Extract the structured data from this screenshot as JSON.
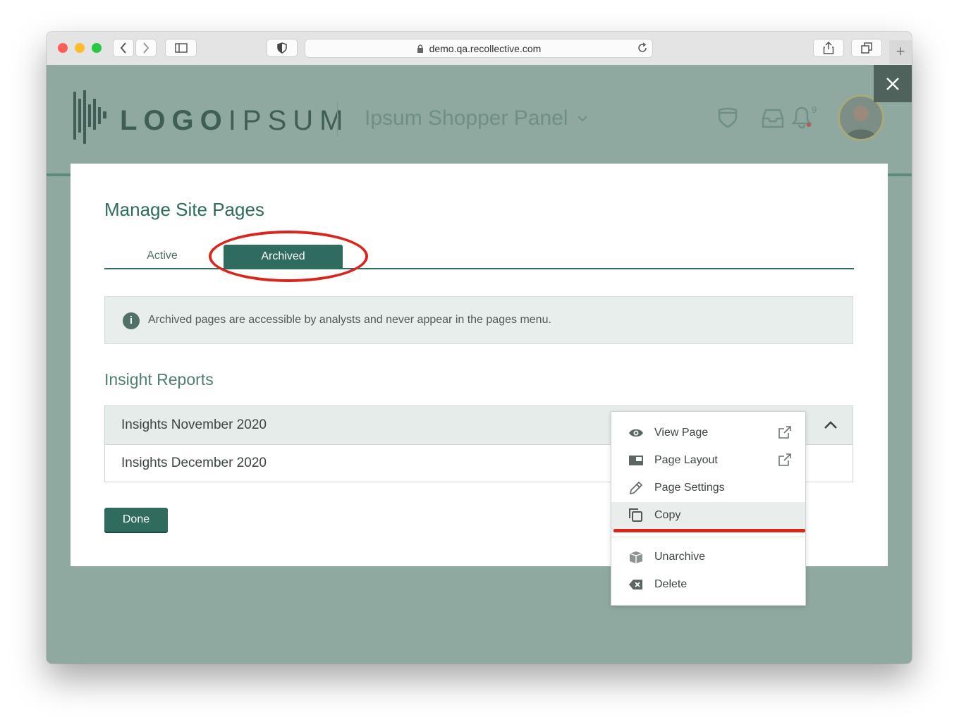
{
  "browser": {
    "url": "demo.qa.recollective.com"
  },
  "header": {
    "logo_text_bold": "LOGO",
    "logo_text_light": "IPSUM",
    "panel_name": "Ipsum Shopper Panel",
    "notification_count": "9"
  },
  "modal": {
    "title": "Manage Site Pages",
    "tabs": [
      {
        "label": "Active",
        "active": false
      },
      {
        "label": "Archived",
        "active": true
      }
    ],
    "info_icon": "i",
    "info_text": "Archived pages are accessible by analysts and never appear in the pages menu.",
    "section_title": "Insight Reports",
    "pages": [
      {
        "title": "Insights November 2020"
      },
      {
        "title": "Insights December 2020"
      }
    ],
    "done_label": "Done"
  },
  "context_menu": {
    "items": [
      {
        "label": "View Page",
        "icon": "eye-icon",
        "external": true
      },
      {
        "label": "Page Layout",
        "icon": "layout-icon",
        "external": true
      },
      {
        "label": "Page Settings",
        "icon": "pencil-icon",
        "external": false
      },
      {
        "label": "Copy",
        "icon": "copy-icon",
        "external": false,
        "highlighted": true
      },
      {
        "label": "Unarchive",
        "icon": "box-icon",
        "external": false
      },
      {
        "label": "Delete",
        "icon": "delete-icon",
        "external": false
      }
    ]
  },
  "colors": {
    "brand": "#2f6b5e",
    "annotation_red": "#d9261c",
    "overlay": "#8fa8a0"
  }
}
